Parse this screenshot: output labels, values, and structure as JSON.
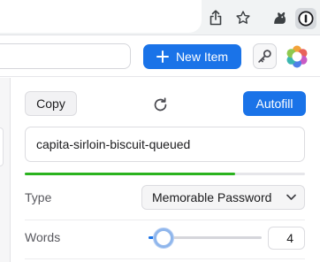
{
  "browser": {
    "icons": [
      "share-icon",
      "bookmark-star-icon",
      "extension-puzzle-icon",
      "onepassword-extension-icon"
    ]
  },
  "header": {
    "new_item_label": "New Item",
    "accent_color": "#1a73e8"
  },
  "generator": {
    "copy_label": "Copy",
    "autofill_label": "Autofill",
    "password": "capita-sirloin-biscuit-queued",
    "strength": 0.75,
    "strength_color": "#2ab31e",
    "type_label": "Type",
    "type_value": "Memorable Password",
    "words_label": "Words",
    "words_value": "4",
    "words_slider_position": 0.13
  }
}
